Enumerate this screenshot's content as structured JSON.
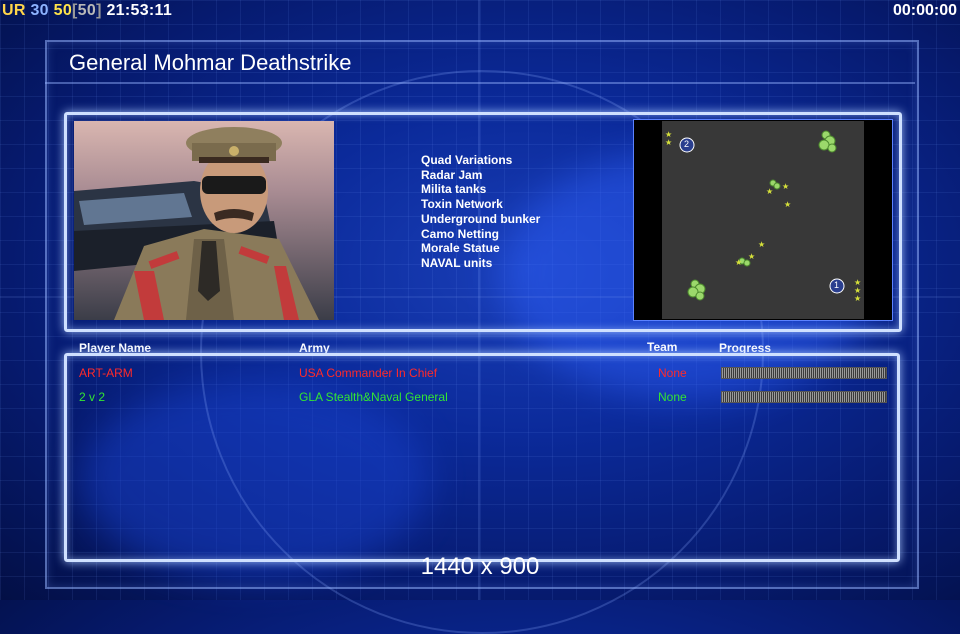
{
  "hud": {
    "ur": "UR",
    "value1": "30",
    "value2": "50",
    "bracket_open": "[",
    "value3": "50",
    "bracket_close": "]",
    "clock": "21:53:11",
    "timer": "00:00:00"
  },
  "general": {
    "name": "General Mohmar Deathstrike",
    "features": [
      "Quad Variations",
      "Radar Jam",
      "Milita tanks",
      "Toxin Network",
      "Underground bunker",
      "Camo Netting",
      "Morale Statue",
      "NAVAL units"
    ]
  },
  "minimap": {
    "start_positions": [
      "2",
      "1"
    ]
  },
  "table": {
    "headers": {
      "player_name": "Player Name",
      "army": "Army",
      "team": "Team",
      "progress": "Progress"
    },
    "rows": [
      {
        "player": "ART-ARM",
        "army": "USA Commander In Chief",
        "team": "None",
        "color": "#ff2a2a"
      },
      {
        "player": "2 v 2",
        "army": "GLA Stealth&Naval General",
        "team": "None",
        "color": "#33e533"
      }
    ]
  },
  "resolution": "1440 x 900"
}
